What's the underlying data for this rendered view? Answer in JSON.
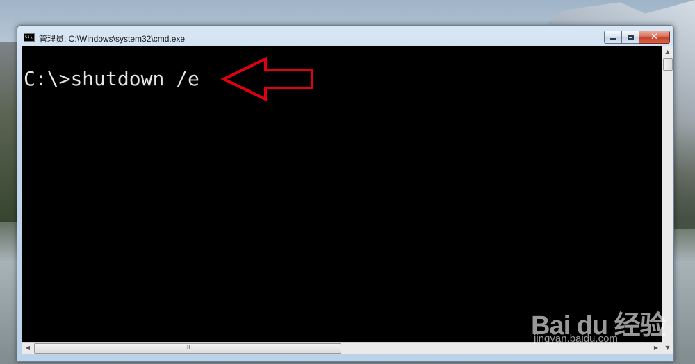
{
  "window": {
    "title": "管理员: C:\\Windows\\system32\\cmd.exe",
    "icon": "cmd-icon",
    "icon_text": "C:\\"
  },
  "console": {
    "prompt": "C:\\>",
    "command": "shutdown /e"
  },
  "annotation": {
    "color": "#e0000f",
    "icon": "red-arrow-icon"
  },
  "scrollbar": {
    "grip_label": "III"
  },
  "watermark": {
    "brand": "Bai du 经验",
    "url": "jingyan.baidu.com"
  }
}
